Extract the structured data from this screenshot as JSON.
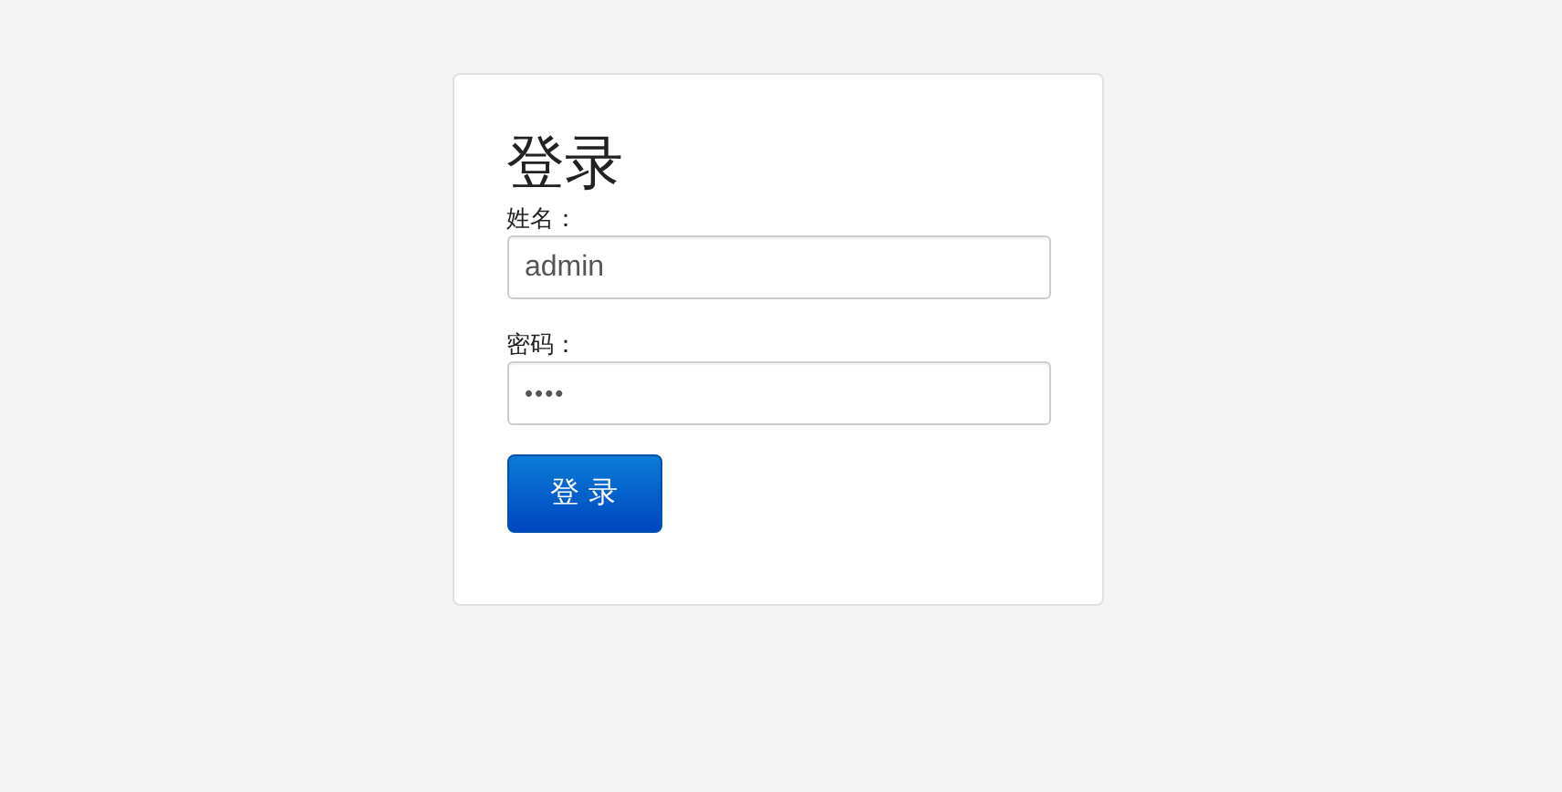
{
  "login_form": {
    "title": "登录",
    "fields": [
      {
        "label": "姓名：",
        "value": "admin"
      },
      {
        "label": "密码：",
        "value": "••••"
      }
    ],
    "submit_button": "登 录"
  }
}
